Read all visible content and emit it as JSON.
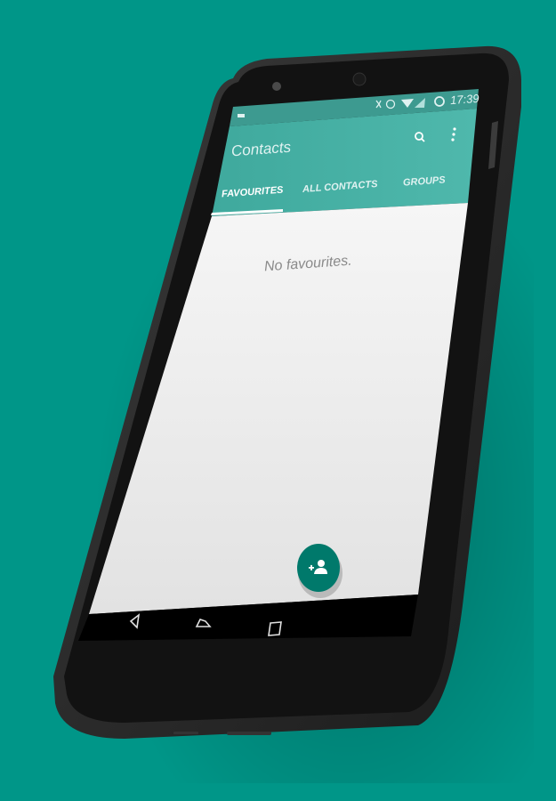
{
  "background_color": "#009688",
  "accent_color": "#4db6ac",
  "fab_color": "#00796b",
  "status_bar": {
    "time": "17:39",
    "icons": [
      "cyanogen-icon",
      "bluetooth-icon",
      "alarm-icon",
      "wifi-icon",
      "signal-icon",
      "battery-charging-icon"
    ]
  },
  "app_bar": {
    "title": "Contacts",
    "actions": [
      "search-icon",
      "more-vert-icon"
    ]
  },
  "tabs": [
    {
      "label": "FAVOURITES",
      "active": true
    },
    {
      "label": "ALL CONTACTS",
      "active": false
    },
    {
      "label": "GROUPS",
      "active": false
    }
  ],
  "content": {
    "empty_message": "No favourites."
  },
  "fab": {
    "icon": "add-contact-icon"
  },
  "nav_bar": {
    "buttons": [
      "back-icon",
      "home-icon",
      "recents-icon"
    ]
  }
}
